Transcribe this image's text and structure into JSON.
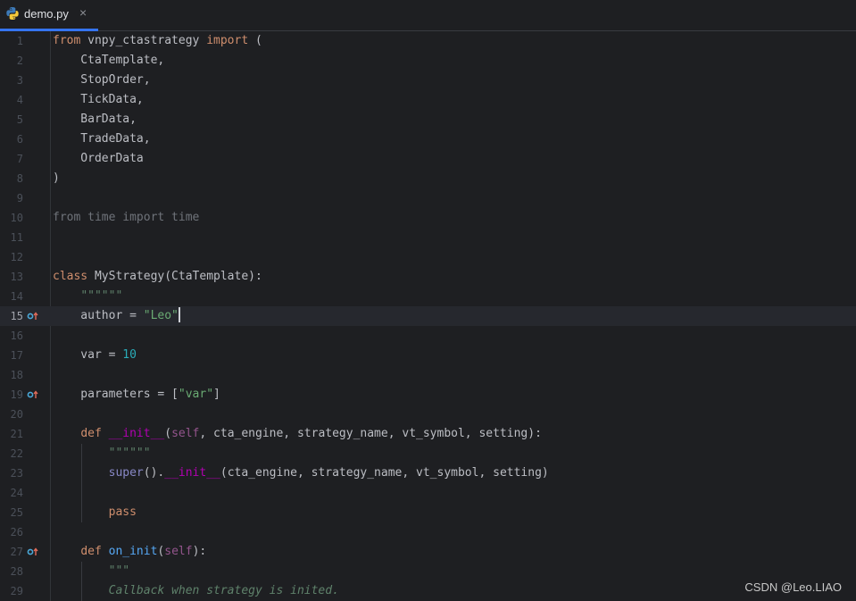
{
  "tab": {
    "filename": "demo.py",
    "close": "×"
  },
  "lines": [
    {
      "num": "1",
      "segs": [
        {
          "t": "from ",
          "c": "kw"
        },
        {
          "t": "vnpy_ctastrategy ",
          "c": "plain"
        },
        {
          "t": "import ",
          "c": "kw"
        },
        {
          "t": "(",
          "c": "plain"
        }
      ]
    },
    {
      "num": "2",
      "segs": [
        {
          "t": "    CtaTemplate,",
          "c": "plain"
        }
      ]
    },
    {
      "num": "3",
      "segs": [
        {
          "t": "    StopOrder,",
          "c": "plain"
        }
      ]
    },
    {
      "num": "4",
      "segs": [
        {
          "t": "    TickData,",
          "c": "plain"
        }
      ]
    },
    {
      "num": "5",
      "segs": [
        {
          "t": "    BarData,",
          "c": "plain"
        }
      ]
    },
    {
      "num": "6",
      "segs": [
        {
          "t": "    TradeData,",
          "c": "plain"
        }
      ]
    },
    {
      "num": "7",
      "segs": [
        {
          "t": "    OrderData",
          "c": "plain"
        }
      ]
    },
    {
      "num": "8",
      "segs": [
        {
          "t": ")",
          "c": "plain"
        }
      ]
    },
    {
      "num": "9",
      "segs": []
    },
    {
      "num": "10",
      "segs": [
        {
          "t": "from time import time",
          "c": "grey"
        }
      ]
    },
    {
      "num": "11",
      "segs": []
    },
    {
      "num": "12",
      "segs": []
    },
    {
      "num": "13",
      "segs": [
        {
          "t": "class ",
          "c": "kw"
        },
        {
          "t": "MyStrategy(CtaTemplate):",
          "c": "plain"
        }
      ]
    },
    {
      "num": "14",
      "segs": [
        {
          "t": "    ",
          "c": "plain"
        },
        {
          "t": "\"\"\"\"\"\"",
          "c": "doc"
        }
      ]
    },
    {
      "num": "15",
      "current": true,
      "marker": true,
      "caret": true,
      "segs": [
        {
          "t": "    author = ",
          "c": "plain"
        },
        {
          "t": "\"Leo\"",
          "c": "str"
        }
      ]
    },
    {
      "num": "16",
      "segs": []
    },
    {
      "num": "17",
      "segs": [
        {
          "t": "    var = ",
          "c": "plain"
        },
        {
          "t": "10",
          "c": "num"
        }
      ]
    },
    {
      "num": "18",
      "segs": []
    },
    {
      "num": "19",
      "marker": true,
      "segs": [
        {
          "t": "    parameters = [",
          "c": "plain"
        },
        {
          "t": "\"var\"",
          "c": "str"
        },
        {
          "t": "]",
          "c": "plain"
        }
      ]
    },
    {
      "num": "20",
      "segs": []
    },
    {
      "num": "21",
      "segs": [
        {
          "t": "    ",
          "c": "plain"
        },
        {
          "t": "def ",
          "c": "kw"
        },
        {
          "t": "__init__",
          "c": "dunder"
        },
        {
          "t": "(",
          "c": "plain"
        },
        {
          "t": "self",
          "c": "self"
        },
        {
          "t": ", cta_engine, strategy_name, vt_symbol, setting):",
          "c": "plain"
        }
      ]
    },
    {
      "num": "22",
      "segs": [
        {
          "t": "        ",
          "c": "plain"
        },
        {
          "t": "\"\"\"\"\"\"",
          "c": "doc"
        }
      ]
    },
    {
      "num": "23",
      "segs": [
        {
          "t": "        ",
          "c": "plain"
        },
        {
          "t": "super",
          "c": "builtin"
        },
        {
          "t": "().",
          "c": "plain"
        },
        {
          "t": "__init__",
          "c": "dunder"
        },
        {
          "t": "(cta_engine, strategy_name, vt_symbol, setting)",
          "c": "plain"
        }
      ]
    },
    {
      "num": "24",
      "segs": []
    },
    {
      "num": "25",
      "segs": [
        {
          "t": "        ",
          "c": "plain"
        },
        {
          "t": "pass",
          "c": "kw"
        }
      ]
    },
    {
      "num": "26",
      "segs": []
    },
    {
      "num": "27",
      "marker": true,
      "segs": [
        {
          "t": "    ",
          "c": "plain"
        },
        {
          "t": "def ",
          "c": "kw"
        },
        {
          "t": "on_init",
          "c": "fn"
        },
        {
          "t": "(",
          "c": "plain"
        },
        {
          "t": "self",
          "c": "self"
        },
        {
          "t": "):",
          "c": "plain"
        }
      ]
    },
    {
      "num": "28",
      "segs": [
        {
          "t": "        ",
          "c": "plain"
        },
        {
          "t": "\"\"\"",
          "c": "doc"
        }
      ]
    },
    {
      "num": "29",
      "segs": [
        {
          "t": "        ",
          "c": "plain"
        },
        {
          "t": "Callback when strategy is inited.",
          "c": "doc"
        }
      ]
    }
  ],
  "watermark": "CSDN @Leo.LIAO",
  "colors": {
    "background": "#1e1f22",
    "tab_accent": "#3574f0",
    "keyword": "#cf8e6d",
    "string": "#6aab73",
    "number": "#2aacb8"
  }
}
